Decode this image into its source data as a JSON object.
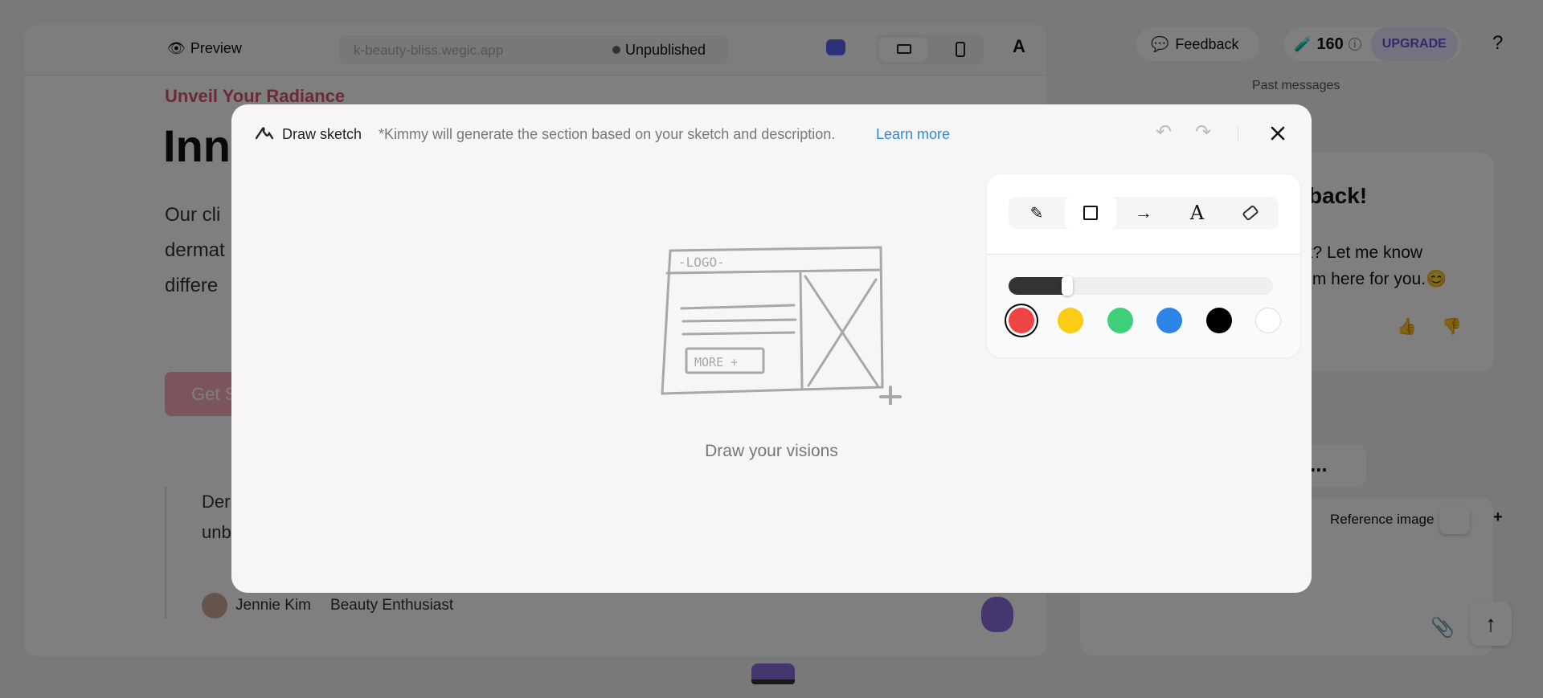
{
  "topbar": {
    "preview_label": "Preview",
    "url": "k-beauty-bliss.wegic.app",
    "status": "Unpublished"
  },
  "site": {
    "eyebrow": "Unveil Your Radiance",
    "heading": "Inno",
    "paragraph_lines": [
      "Our cli",
      "dermat",
      "differe"
    ],
    "cta": "Get S",
    "quote_lines": [
      "Der",
      "unb"
    ],
    "author": "Jennie Kim",
    "author_role": "Beauty Enthusiast"
  },
  "right": {
    "feedback": "Feedback",
    "credits": "160",
    "upgrade": "UPGRADE",
    "help": "?",
    "past_messages": "Past messages",
    "message": {
      "title": "back!",
      "lines": [
        "k? Let me know",
        "I'm here for you."
      ],
      "emoji": "😊"
    },
    "typing": "...",
    "reference_image": "Reference image",
    "add": "+"
  },
  "modal": {
    "title": "Draw sketch",
    "description": "*Kimmy will generate the section based on your sketch and description.",
    "learn_more": "Learn more",
    "placeholder": "Draw your visions",
    "sketch": {
      "logo": "-LOGO-",
      "more": "MORE +"
    },
    "tools": [
      {
        "name": "pencil",
        "selected": false
      },
      {
        "name": "rectangle",
        "selected": true
      },
      {
        "name": "arrow",
        "selected": false
      },
      {
        "name": "text",
        "selected": false
      },
      {
        "name": "eraser",
        "selected": false
      }
    ],
    "stroke_size_fraction": 0.2,
    "colors": [
      "#ef4444",
      "#facc15",
      "#3ecf7a",
      "#2b84e8",
      "#000000",
      "#ffffff"
    ],
    "selected_color": "#ef4444"
  },
  "colors": {
    "accent": "#2b8ae0",
    "brand_pink": "#d9546f",
    "upgrade": "#6d4fd8"
  }
}
